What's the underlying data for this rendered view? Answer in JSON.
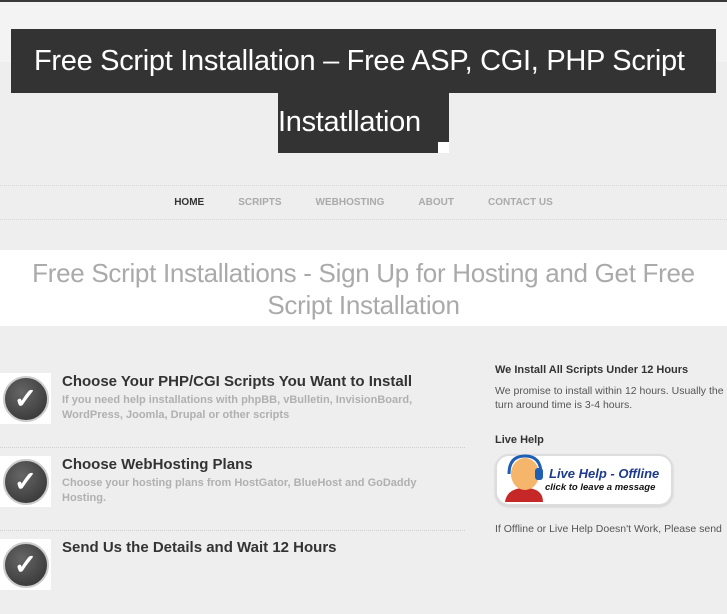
{
  "site": {
    "title_line1": "Free Script Installation – Free ASP, CGI, PHP Script",
    "title_line2": "Instatllation"
  },
  "nav": [
    {
      "label": "HOME",
      "active": true
    },
    {
      "label": "SCRIPTS"
    },
    {
      "label": "WEBHOSTING"
    },
    {
      "label": "ABOUT"
    },
    {
      "label": "CONTACT US"
    }
  ],
  "banner": {
    "line1": "Free Script Installations - Sign Up for Hosting and Get Free",
    "line2": "Script Installation"
  },
  "steps": [
    {
      "title": "Choose Your PHP/CGI Scripts You Want to Install",
      "desc": "If you need help installations with phpBB, vBulletin, InvisionBoard, WordPress, Joomla, Drupal or other scripts"
    },
    {
      "title": "Choose WebHosting Plans",
      "desc": "Choose your hosting plans from HostGator, BlueHost and GoDaddy Hosting."
    },
    {
      "title": "Send Us the Details and Wait 12 Hours",
      "desc": ""
    }
  ],
  "sidebar": {
    "h1": "We Install All Scripts Under 12 Hours",
    "p1": "We promise to install within 12 hours. Usually the turn around time is 3-4 hours.",
    "h2": "Live Help",
    "livehelp_title": "Live Help - Offline",
    "livehelp_sub": "click to leave a message",
    "p2": "If Offline or Live Help Doesn't Work, Please send"
  }
}
